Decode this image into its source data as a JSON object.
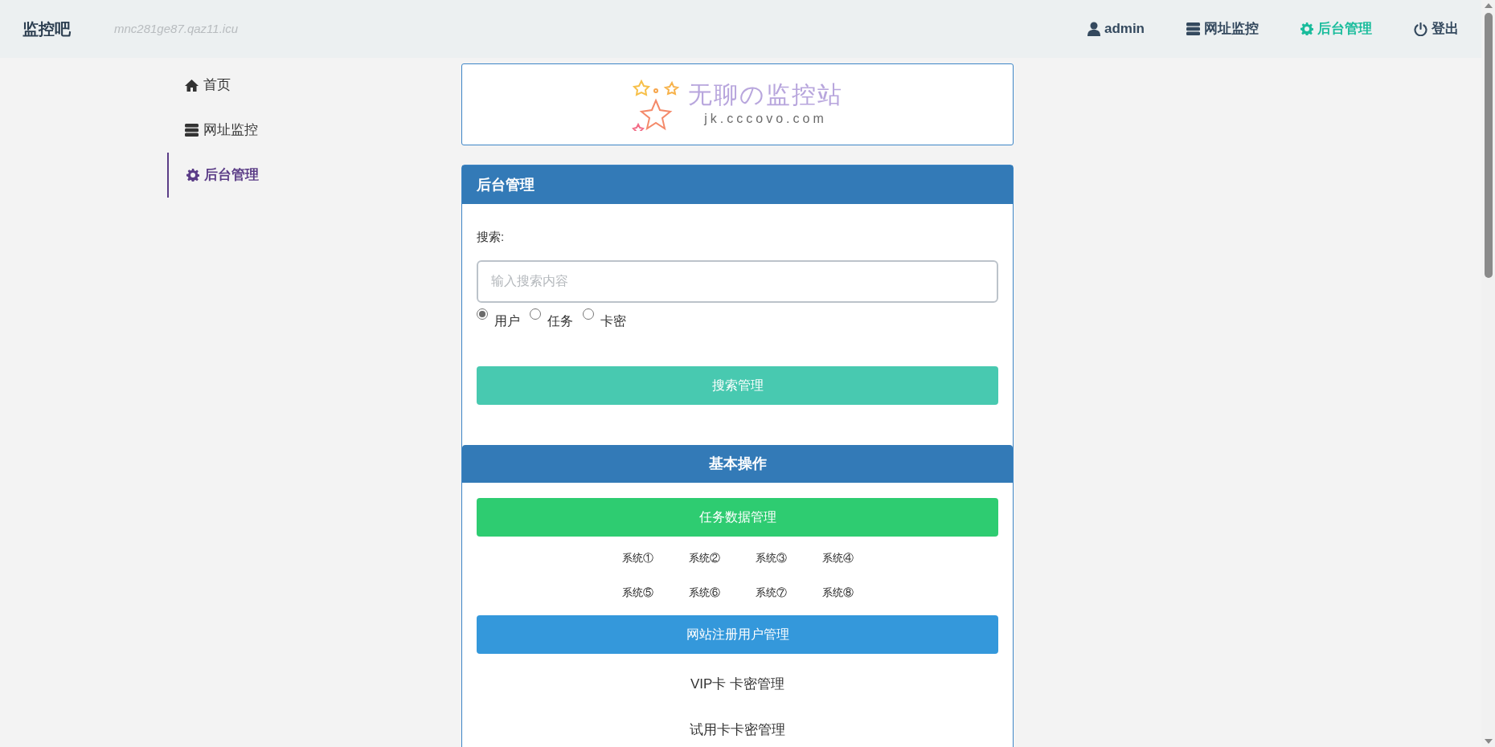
{
  "header": {
    "brand": "监控吧",
    "domain": "mnc281ge87.qaz11.icu",
    "nav": [
      {
        "label": "admin",
        "selected": false
      },
      {
        "label": "网址监控",
        "selected": false
      },
      {
        "label": "后台管理",
        "selected": true
      },
      {
        "label": "登出",
        "selected": false
      }
    ]
  },
  "sidebar": {
    "items": [
      {
        "label": "首页",
        "selected": false
      },
      {
        "label": "网址监控",
        "selected": false
      },
      {
        "label": "后台管理",
        "selected": true
      }
    ]
  },
  "logo": {
    "title": "无聊の监控站",
    "domain": "jk.cccovo.com"
  },
  "admin_panel": {
    "title": "后台管理",
    "search_label": "搜索:",
    "search": {
      "placeholder": "输入搜索内容"
    },
    "options": [
      {
        "label": "用户",
        "selected": true
      },
      {
        "label": "任务",
        "selected": false
      },
      {
        "label": "卡密",
        "selected": false
      }
    ],
    "search_button": "搜索管理"
  },
  "basic_panel": {
    "title": "基本操作",
    "task_button": "任务数据管理",
    "systems": [
      "系统①",
      "系统②",
      "系统③",
      "系统④",
      "系统⑤",
      "系统⑥",
      "系统⑦",
      "系统⑧"
    ],
    "users_button": "网站注册用户管理",
    "links": [
      "VIP卡 卡密管理",
      "试用卡卡密管理"
    ]
  }
}
